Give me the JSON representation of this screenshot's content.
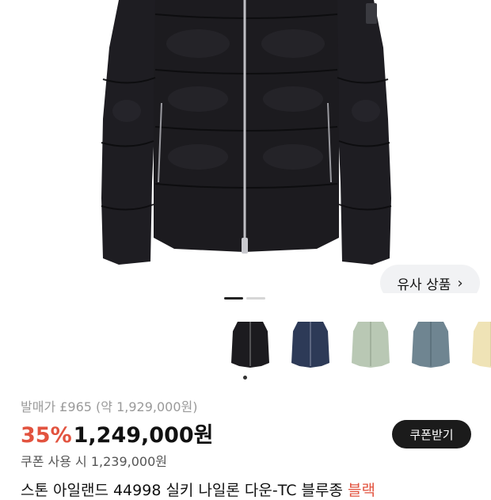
{
  "product": {
    "similar_button_label": "유사 상품",
    "original_price": "발매가 £965 (약 1,929,000원)",
    "discount": "35%",
    "sale_price": "1,249,000원",
    "coupon_price": "쿠폰 사용 시 1,239,000원",
    "coupon_button_label": "쿠폰받기",
    "title": "스톤 아일랜드 44998 실키 나일론 다운-TC 블루종",
    "title_brand_tail": "블랙"
  },
  "carousel": {
    "pages": 2,
    "active_page": 1
  },
  "thumbnails": [
    {
      "name": "black",
      "color": "#1c1b1f"
    },
    {
      "name": "navy",
      "color": "#2d3a57"
    },
    {
      "name": "sage",
      "color": "#b9c8b4"
    },
    {
      "name": "slate",
      "color": "#6f8591"
    },
    {
      "name": "cream",
      "color": "#efe3b6"
    }
  ],
  "colors": {
    "accent": "#e2533f",
    "jacket": "#1c1b1f"
  }
}
